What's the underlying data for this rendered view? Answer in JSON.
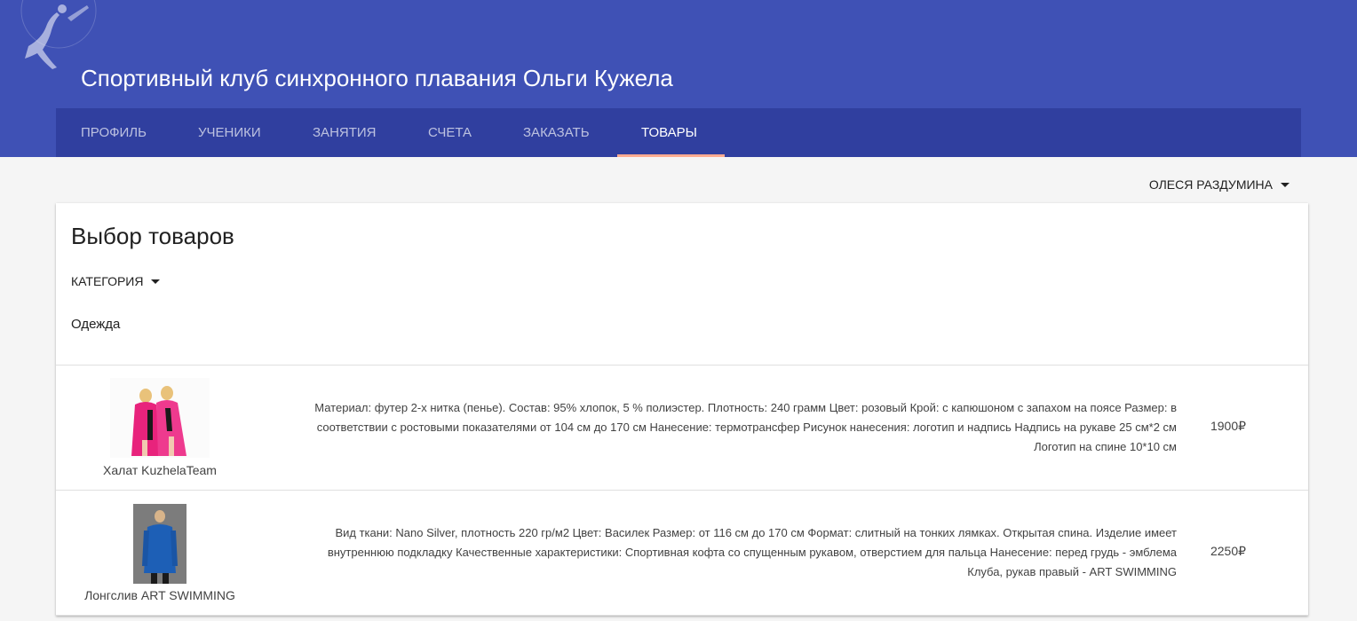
{
  "app": {
    "title": "Спортивный клуб синхронного плавания Ольги Кужела"
  },
  "nav": {
    "tabs": [
      {
        "label": "ПРОФИЛЬ"
      },
      {
        "label": "УЧЕНИКИ"
      },
      {
        "label": "ЗАНЯТИЯ"
      },
      {
        "label": "СЧЕТА"
      },
      {
        "label": "ЗАКАЗАТЬ"
      },
      {
        "label": "ТОВАРЫ",
        "active": true
      }
    ]
  },
  "user": {
    "name": "ОЛЕСЯ РАЗДУМИНА"
  },
  "page": {
    "title": "Выбор товаров",
    "category_label": "КАТЕГОРИЯ",
    "category_value": "Одежда"
  },
  "products": [
    {
      "name": "Халат KuzhelaTeam",
      "description": "Материал: футер 2-х нитка (пенье). Состав: 95% хлопок, 5 % полиэстер. Плотность: 240 грамм Цвет: розовый Крой: с капюшоном с запахом на поясе Размер: в соответствии с ростовыми показателями от 104 см до 170 см Нанесение: термотрансфер Рисунок нанесения: логотип и надпись Надпись на рукаве 25 см*2 см Логотип на спине 10*10 см",
      "price": "1900₽",
      "image_icon": "robe-photo"
    },
    {
      "name": "Лонгслив ART SWIMMING",
      "description": "Вид ткани: Nano Silver, плотность 220 гр/м2 Цвет: Василек Размер: от 116 см до 170 см Формат: слитный на тонких лямках. Открытая спина. Изделие имеет внутреннюю подкладку Качественные характеристики: Спортивная кофта со спущенным рукавом, отверстием для пальца Нанесение: перед грудь - эмблема Клуба, рукав правый - ART SWIMMING",
      "price": "2250₽",
      "image_icon": "longsleeve-photo"
    }
  ],
  "colors": {
    "header": "#3f51b5",
    "navbar": "#303f9f",
    "active_underline": "#ffab91",
    "background": "#f5f5f5"
  }
}
